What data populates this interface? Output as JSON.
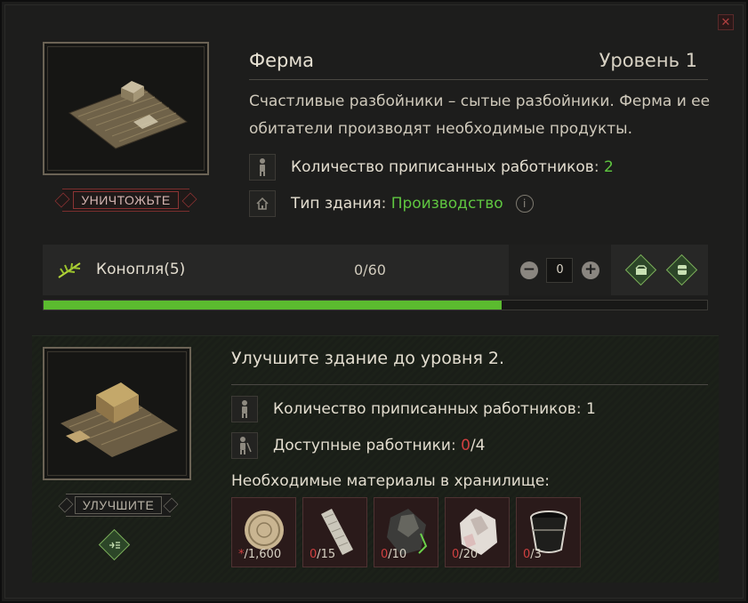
{
  "building": {
    "title": "Ферма",
    "level_label": "Уровень 1",
    "description": "Счастливые разбойники – сытые разбойники. Ферма и ее обитатели производят необходимые продукты.",
    "workers_label": "Количество приписанных работников",
    "workers_value": "2",
    "type_label": "Тип здания",
    "type_value": "Производство",
    "destroy_button": "УНИЧТОЖЬТЕ",
    "help_glyph": "i"
  },
  "production": {
    "item_name": "Конопля",
    "item_qty": "(5)",
    "progress_text": "0/60",
    "quantity_input": "0",
    "progress_fraction": 0.69,
    "minus_glyph": "−",
    "plus_glyph": "+"
  },
  "upgrade": {
    "title": "Улучшите здание до уровня 2.",
    "workers_label": "Количество приписанных работников",
    "workers_value": "1",
    "available_label": "Доступные работники",
    "available_current": "0",
    "available_total": "/4",
    "materials_title": "Необходимые материалы в хранилище:",
    "upgrade_button": "УЛУЧШИТЕ",
    "materials": [
      {
        "have": "*",
        "need": "/1,600",
        "icon": "coin-icon"
      },
      {
        "have": "0",
        "need": "/15",
        "icon": "rope-icon"
      },
      {
        "have": "0",
        "need": "/10",
        "icon": "coal-icon"
      },
      {
        "have": "0",
        "need": "/20",
        "icon": "stone-icon"
      },
      {
        "have": "0",
        "need": "/3",
        "icon": "bucket-icon"
      }
    ]
  },
  "colors": {
    "accent_green": "#5fc640",
    "warning_red": "#d04040",
    "progress_green": "#5bbb2f"
  },
  "icons": {
    "close": "close-icon",
    "worker": "worker-icon",
    "house": "house-icon",
    "hemp": "hemp-icon",
    "box": "box-icon",
    "chest": "chest-icon",
    "list": "list-icon"
  },
  "close_glyph": "✕"
}
